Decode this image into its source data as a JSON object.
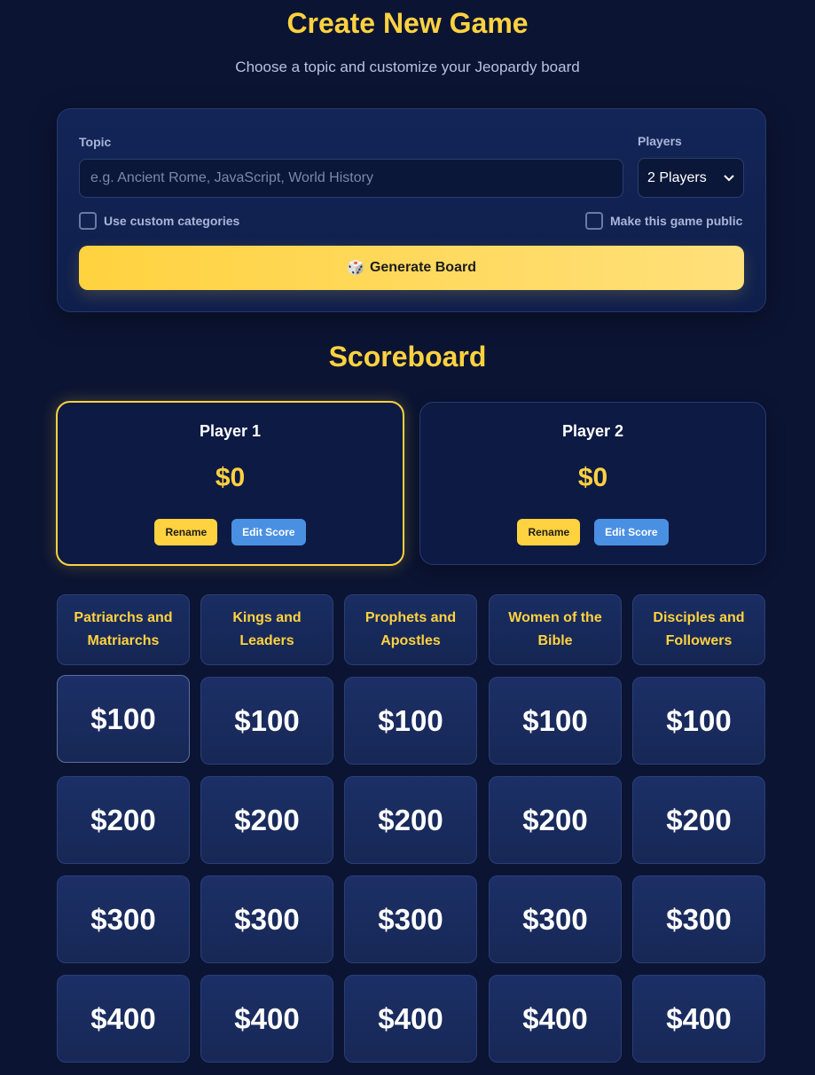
{
  "header": {
    "title": "Create New Game",
    "subtitle": "Choose a topic and customize your Jeopardy board"
  },
  "form": {
    "topic_label": "Topic",
    "topic_placeholder": "e.g. Ancient Rome, JavaScript, World History",
    "topic_value": "",
    "players_label": "Players",
    "players_selected": "2 Players",
    "custom_categories_label": "Use custom categories",
    "custom_categories_checked": false,
    "public_label": "Make this game public",
    "public_checked": false,
    "generate_icon": "🎲",
    "generate_label": "Generate Board"
  },
  "scoreboard": {
    "title": "Scoreboard",
    "players": [
      {
        "name": "Player 1",
        "score": "$0",
        "active": true,
        "rename_label": "Rename",
        "edit_label": "Edit Score"
      },
      {
        "name": "Player 2",
        "score": "$0",
        "active": false,
        "rename_label": "Rename",
        "edit_label": "Edit Score"
      }
    ]
  },
  "board": {
    "categories": [
      "Patriarchs and Matriarchs",
      "Kings and Leaders",
      "Prophets and Apostles",
      "Women of the Bible",
      "Disciples and Followers"
    ],
    "values": [
      "$100",
      "$200",
      "$300",
      "$400"
    ]
  },
  "colors": {
    "background": "#0b1433",
    "accent": "#ffd23f",
    "button_blue": "#4a90e2"
  }
}
